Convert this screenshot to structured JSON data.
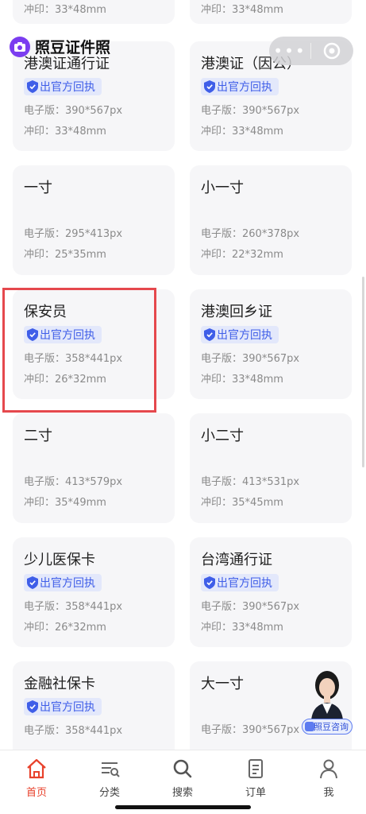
{
  "header": {
    "app_name": "照豆证件照"
  },
  "cards": [
    {
      "title": "",
      "badge": "",
      "e_spec": "",
      "print_spec": "冲印：33*48mm"
    },
    {
      "title": "",
      "badge": "",
      "e_spec": "",
      "print_spec": "冲印：33*48mm"
    },
    {
      "title": "港澳证通行证",
      "badge": "出官方回执",
      "e_spec": "电子版：390*567px",
      "print_spec": "冲印：33*48mm"
    },
    {
      "title": "港澳证（因公）",
      "badge": "出官方回执",
      "e_spec": "电子版：390*567px",
      "print_spec": "冲印：33*48mm"
    },
    {
      "title": "一寸",
      "badge": "",
      "e_spec": "电子版：295*413px",
      "print_spec": "冲印：25*35mm"
    },
    {
      "title": "小一寸",
      "badge": "",
      "e_spec": "电子版：260*378px",
      "print_spec": "冲印：22*32mm"
    },
    {
      "title": "保安员",
      "badge": "出官方回执",
      "e_spec": "电子版：358*441px",
      "print_spec": "冲印：26*32mm"
    },
    {
      "title": "港澳回乡证",
      "badge": "出官方回执",
      "e_spec": "电子版：390*567px",
      "print_spec": "冲印：33*48mm"
    },
    {
      "title": "二寸",
      "badge": "",
      "e_spec": "电子版：413*579px",
      "print_spec": "冲印：35*49mm"
    },
    {
      "title": "小二寸",
      "badge": "",
      "e_spec": "电子版：413*531px",
      "print_spec": "冲印：35*45mm"
    },
    {
      "title": "少儿医保卡",
      "badge": "出官方回执",
      "e_spec": "电子版：358*441px",
      "print_spec": "冲印：26*32mm"
    },
    {
      "title": "台湾通行证",
      "badge": "出官方回执",
      "e_spec": "电子版：390*567px",
      "print_spec": "冲印：33*48mm"
    },
    {
      "title": "金融社保卡",
      "badge": "出官方回执",
      "e_spec": "电子版：358*441px",
      "print_spec": ""
    },
    {
      "title": "大一寸",
      "badge": "",
      "e_spec": "电子版：390*567px",
      "print_spec": ""
    }
  ],
  "consult": {
    "label": "照豆咨询"
  },
  "tabbar": {
    "tabs": [
      {
        "label": "首页",
        "icon": "home-icon",
        "active": true
      },
      {
        "label": "分类",
        "icon": "category-icon",
        "active": false
      },
      {
        "label": "搜索",
        "icon": "search-icon",
        "active": false
      },
      {
        "label": "订单",
        "icon": "order-icon",
        "active": false
      },
      {
        "label": "我",
        "icon": "profile-icon",
        "active": false
      }
    ]
  },
  "colors": {
    "accent": "#e8412b",
    "badge_text": "#3f5ee8",
    "badge_bg": "#e3e8fb",
    "highlight": "#e5484d"
  }
}
